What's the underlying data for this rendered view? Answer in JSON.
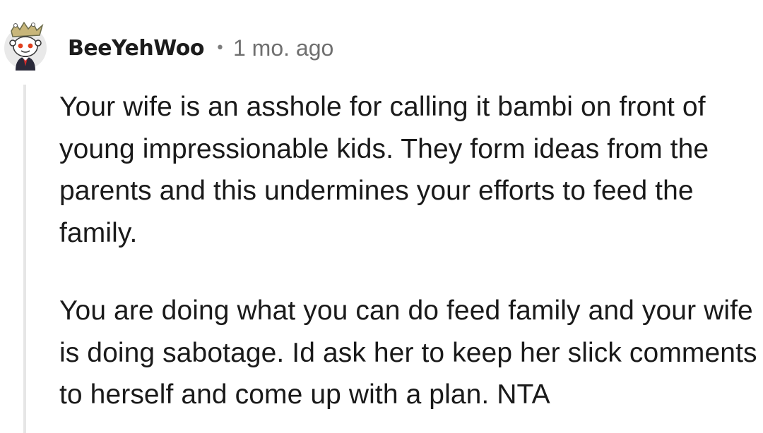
{
  "comment": {
    "author": {
      "username": "BeeYehWoo",
      "avatar_icon": "snoo-avatar-with-crown-icon"
    },
    "separator": "•",
    "timestamp": "1 mo. ago",
    "body": [
      "Your wife is an asshole for calling it bambi on front of young impressionable kids. They form ideas from the parents and this undermines your efforts to feed the family.",
      "You are doing what you can do feed family and your wife is doing sabotage. Id ask her to keep her slick comments to herself and come up with a plan. NTA"
    ]
  },
  "colors": {
    "text": "#1a1a1a",
    "meta": "#6f6f6f",
    "thread_line": "#e6e6e6",
    "background": "#ffffff"
  }
}
